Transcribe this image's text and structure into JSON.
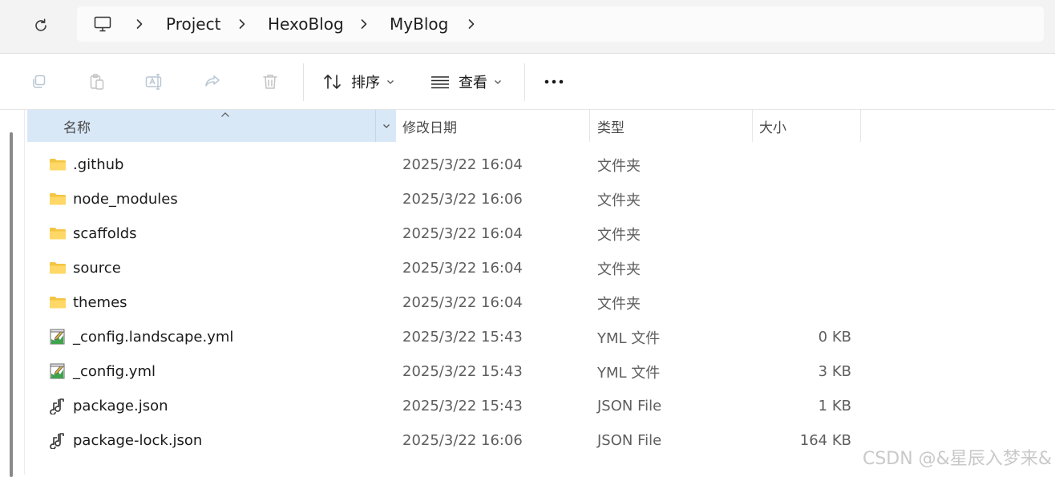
{
  "breadcrumb": {
    "items": [
      "Project",
      "HexoBlog",
      "MyBlog"
    ]
  },
  "toolbar": {
    "sort_label": "排序",
    "view_label": "查看"
  },
  "columns": {
    "name": "名称",
    "modified": "修改日期",
    "type": "类型",
    "size": "大小"
  },
  "files": [
    {
      "name": ".github",
      "modified": "2025/3/22 16:04",
      "type": "文件夹",
      "size": "",
      "icon": "folder-icon"
    },
    {
      "name": "node_modules",
      "modified": "2025/3/22 16:06",
      "type": "文件夹",
      "size": "",
      "icon": "folder-icon"
    },
    {
      "name": "scaffolds",
      "modified": "2025/3/22 16:04",
      "type": "文件夹",
      "size": "",
      "icon": "folder-icon"
    },
    {
      "name": "source",
      "modified": "2025/3/22 16:04",
      "type": "文件夹",
      "size": "",
      "icon": "folder-icon"
    },
    {
      "name": "themes",
      "modified": "2025/3/22 16:04",
      "type": "文件夹",
      "size": "",
      "icon": "folder-icon"
    },
    {
      "name": "_config.landscape.yml",
      "modified": "2025/3/22 15:43",
      "type": "YML 文件",
      "size": "0 KB",
      "icon": "yml-file-icon"
    },
    {
      "name": "_config.yml",
      "modified": "2025/3/22 15:43",
      "type": "YML 文件",
      "size": "3 KB",
      "icon": "yml-file-icon"
    },
    {
      "name": "package.json",
      "modified": "2025/3/22 15:43",
      "type": "JSON File",
      "size": "1 KB",
      "icon": "json-file-icon"
    },
    {
      "name": "package-lock.json",
      "modified": "2025/3/22 16:06",
      "type": "JSON File",
      "size": "164 KB",
      "icon": "json-file-icon"
    }
  ],
  "watermark": "CSDN @&星辰入梦来&",
  "colors": {
    "header_selected": "#d9e8f7",
    "folder": "#f4c542",
    "accent": "#0067c0"
  }
}
